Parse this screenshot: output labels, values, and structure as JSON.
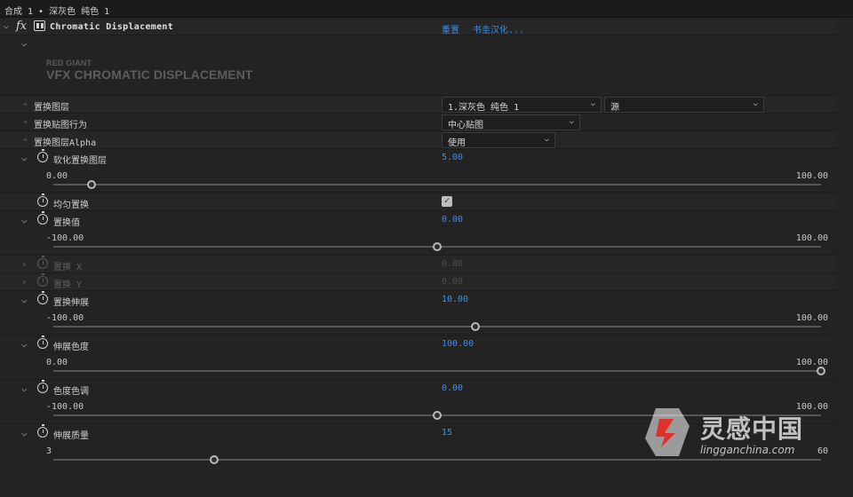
{
  "title_bar": "合成 1 • 深灰色 纯色 1",
  "effect": {
    "name": "Chromatic Displacement",
    "reset_label": "重置",
    "about_label": "书圭汉化...",
    "logo_small": "RED GIANT",
    "logo_big": "VFX CHROMATIC DISPLACEMENT"
  },
  "params": {
    "displacement_layer": {
      "label": "置换图层",
      "layer_value": "1.深灰色 纯色 1",
      "source_value": "源"
    },
    "map_behavior": {
      "label": "置换贴图行为",
      "value": "中心贴图"
    },
    "alpha": {
      "label": "置换图层Alpha",
      "value": "使用"
    },
    "soften": {
      "label": "软化置换图层",
      "value": "5.00",
      "min": "0.00",
      "max": "100.00",
      "fraction": 0.05
    },
    "uniform": {
      "label": "均匀置换",
      "checked": true,
      "check_glyph": "✓"
    },
    "amount": {
      "label": "置换值",
      "value": "0.00",
      "min": "-100.00",
      "max": "100.00",
      "fraction": 0.5
    },
    "disp_x": {
      "label": "置换 X",
      "value": "0.00"
    },
    "disp_y": {
      "label": "置换 Y",
      "value": "0.00"
    },
    "spread": {
      "label": "置换伸展",
      "value": "10.00",
      "min": "-100.00",
      "max": "100.00",
      "fraction": 0.55
    },
    "spread_chroma": {
      "label": "伸展色度",
      "value": "100.00",
      "min": "0.00",
      "max": "100.00",
      "fraction": 1.0
    },
    "chroma_hue": {
      "label": "色度色调",
      "value": "0.00",
      "min": "-100.00",
      "max": "100.00",
      "fraction": 0.5
    },
    "spread_quality": {
      "label": "伸展质量",
      "value": "15",
      "min": "3",
      "max": "60",
      "fraction": 0.21
    }
  },
  "watermark": {
    "cn": "灵感中国",
    "en": "lingganchina.com"
  },
  "colors": {
    "accent": "#3d8ee6",
    "panel": "#232323",
    "watermark_red": "#e0322a"
  }
}
